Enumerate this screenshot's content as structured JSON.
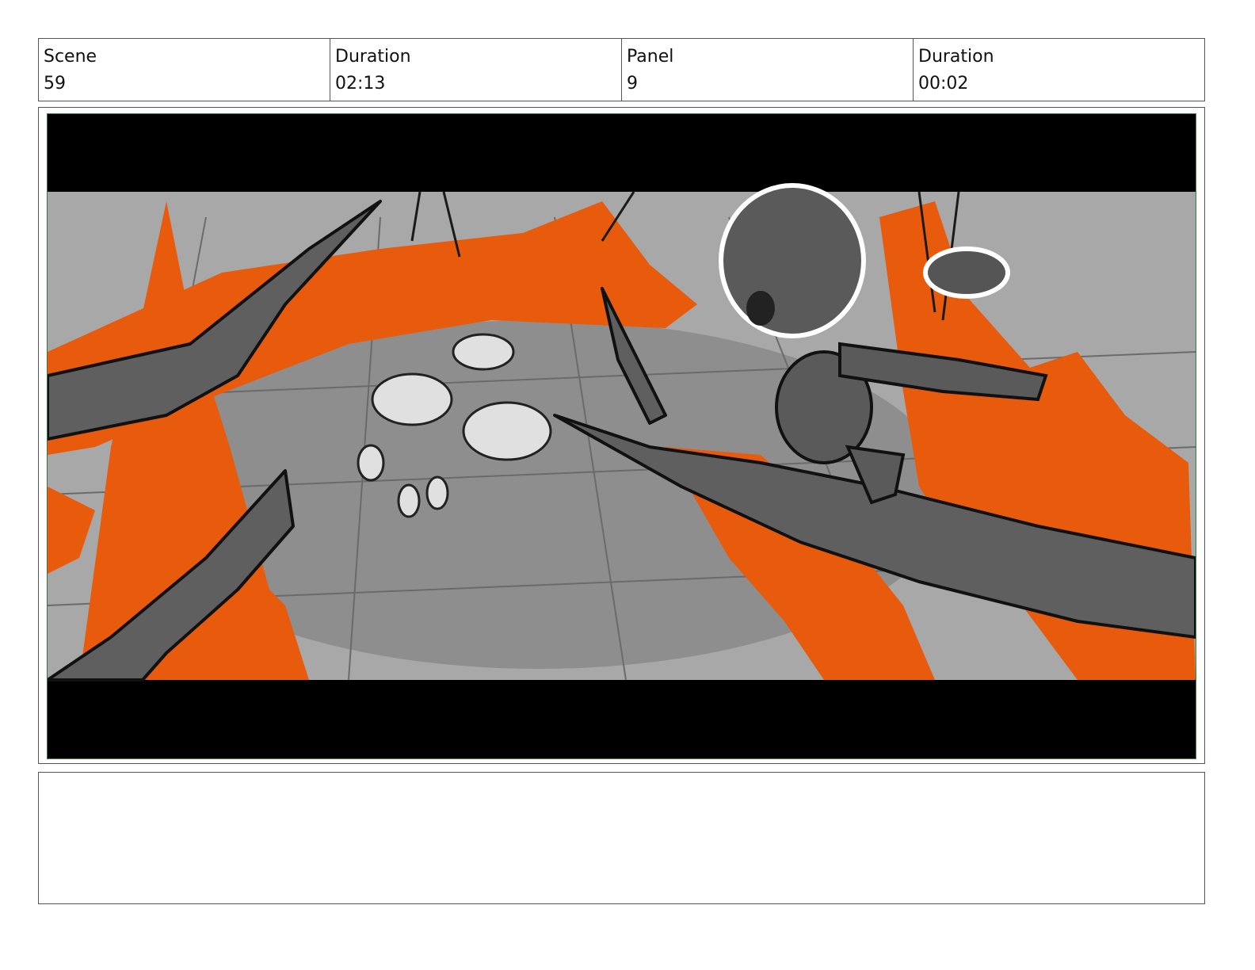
{
  "header": {
    "scene_label": "Scene",
    "scene_value": "59",
    "scene_duration_label": "Duration",
    "scene_duration_value": "02:13",
    "panel_label": "Panel",
    "panel_value": "9",
    "panel_duration_label": "Duration",
    "panel_duration_value": "00:02"
  },
  "panel": {
    "colors": {
      "fire": "#e85a0c",
      "ground": "#9c9c9c",
      "branch": "#5a5a5a",
      "letterbox": "#000000"
    }
  },
  "notes": {
    "text": ""
  }
}
